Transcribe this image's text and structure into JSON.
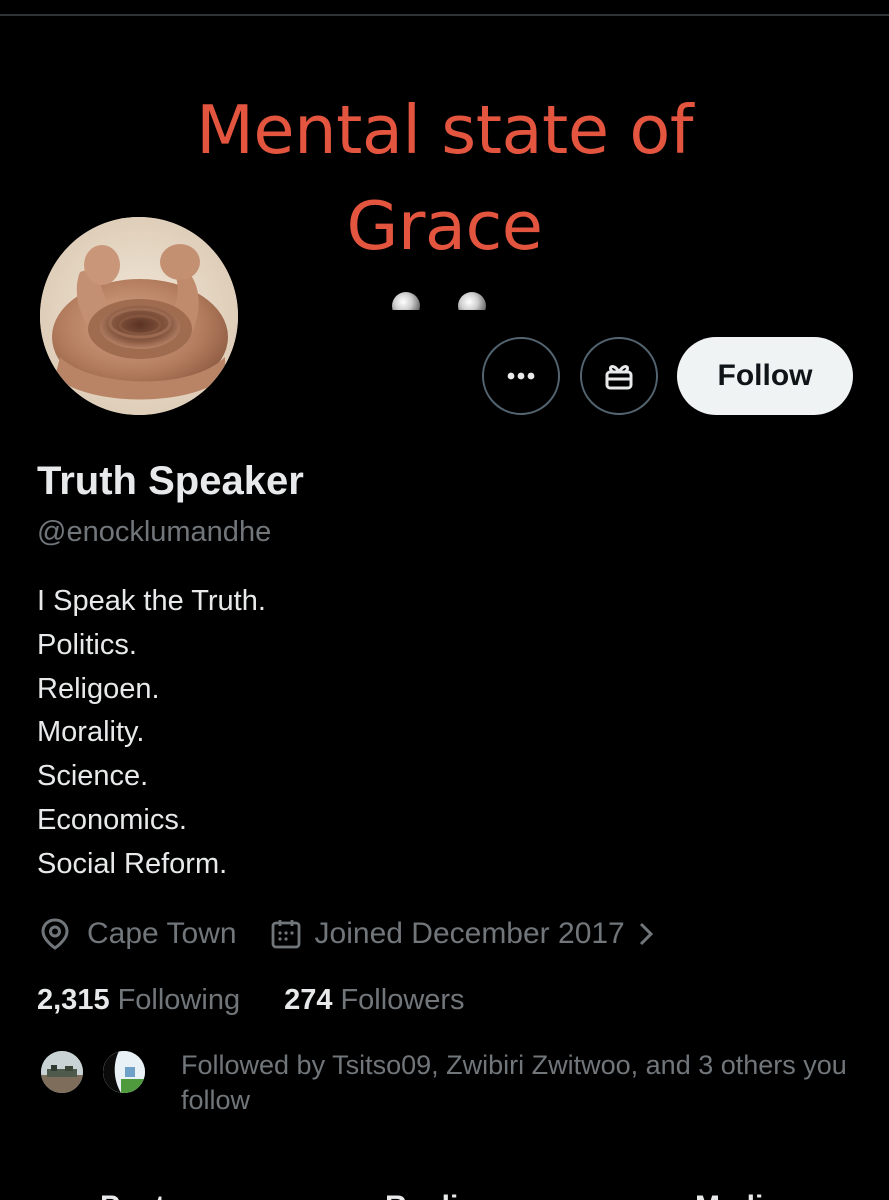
{
  "banner": {
    "text_line1": "Mental state of",
    "text_line2": "Grace"
  },
  "actions": {
    "more_icon": "ellipsis-icon",
    "gift_icon": "gift-icon",
    "follow_label": "Follow"
  },
  "profile": {
    "display_name": "Truth Speaker",
    "handle": "@enocklumandhe",
    "bio": [
      "I Speak the Truth.",
      "Politics.",
      "Religoen.",
      "Morality.",
      "Science.",
      "Economics.",
      "Social Reform."
    ],
    "location": "Cape Town",
    "joined": "Joined December 2017"
  },
  "stats": {
    "following_count": "2,315",
    "following_label": "Following",
    "followers_count": "274",
    "followers_label": "Followers"
  },
  "followed_by": {
    "text": "Followed by Tsitso09, Zwibiri Zwitwoo, and 3 others you follow"
  },
  "tabs": [
    "Posts",
    "Replies",
    "Media"
  ],
  "colors": {
    "background": "#000000",
    "banner_text": "#e3553f",
    "primary_text": "#e7e9ea",
    "secondary_text": "#71767b",
    "follow_button_bg": "#eff3f4"
  }
}
